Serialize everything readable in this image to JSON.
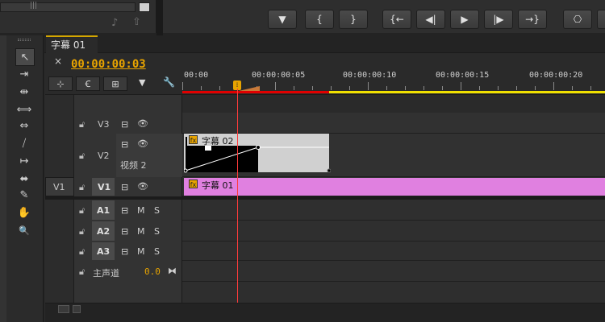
{
  "top_left_panel": {
    "scrollbar_grip": "|||",
    "close_icon": "■",
    "audio_icon": "♪",
    "export_icon": "⇧"
  },
  "transport": {
    "buttons": [
      {
        "name": "add-marker-button",
        "glyph": "▼"
      },
      {
        "name": "mark-in-button",
        "glyph": "{"
      },
      {
        "name": "mark-out-button",
        "glyph": "}"
      },
      {
        "name": "go-to-in-button",
        "glyph": "{←"
      },
      {
        "name": "step-back-button",
        "glyph": "◀|"
      },
      {
        "name": "play-button",
        "glyph": "▶"
      },
      {
        "name": "step-forward-button",
        "glyph": "|▶"
      },
      {
        "name": "go-to-out-button",
        "glyph": "→}"
      },
      {
        "name": "lift-button",
        "glyph": "⎔"
      }
    ]
  },
  "tools": [
    {
      "name": "selection-tool-icon",
      "glyph": "↖"
    },
    {
      "name": "track-select-tool-icon",
      "glyph": "⇥"
    },
    {
      "name": "ripple-edit-tool-icon",
      "glyph": "⇹"
    },
    {
      "name": "rolling-edit-tool-icon",
      "glyph": "⟺"
    },
    {
      "name": "rate-stretch-tool-icon",
      "glyph": "⇔"
    },
    {
      "name": "razor-tool-icon",
      "glyph": "⧸"
    },
    {
      "name": "slip-tool-icon",
      "glyph": "↦"
    },
    {
      "name": "slide-tool-icon",
      "glyph": "⬌"
    },
    {
      "name": "pen-tool-icon",
      "glyph": "✎"
    },
    {
      "name": "hand-tool-icon",
      "glyph": "✋"
    },
    {
      "name": "zoom-tool-icon",
      "glyph": "🔍"
    }
  ],
  "timeline": {
    "tab_label": "字幕 01",
    "tab_close": "×",
    "timecode": "00:00:00:03",
    "ruler_labels": [
      "00:00",
      "00:00:00:05",
      "00:00:00:10",
      "00:00:00:15",
      "00:00:00:20"
    ],
    "playhead_glyph": "⁞",
    "tracks": {
      "v3": {
        "name": "V3"
      },
      "v2": {
        "name": "V2",
        "sublabel": "视频 2"
      },
      "v1": {
        "source": "V1",
        "name": "V1"
      },
      "a1": {
        "name": "A1"
      },
      "a2": {
        "name": "A2"
      },
      "a3": {
        "name": "A3"
      },
      "master": {
        "name": "主声道",
        "value": "0.0"
      }
    },
    "mute_label": "M",
    "solo_label": "S",
    "clips": {
      "v2_clip": {
        "label": "字幕 02",
        "fx": "fx"
      },
      "v1_clip": {
        "label": "字幕 01",
        "fx": "fx"
      }
    },
    "colors": {
      "accent": "#e8a400",
      "v1_clip": "#e080e0",
      "v2_clip": "#d0d0d0",
      "work_area": "#f0e000",
      "render_bar": "#e00000",
      "playhead": "#ff3b3b"
    }
  }
}
